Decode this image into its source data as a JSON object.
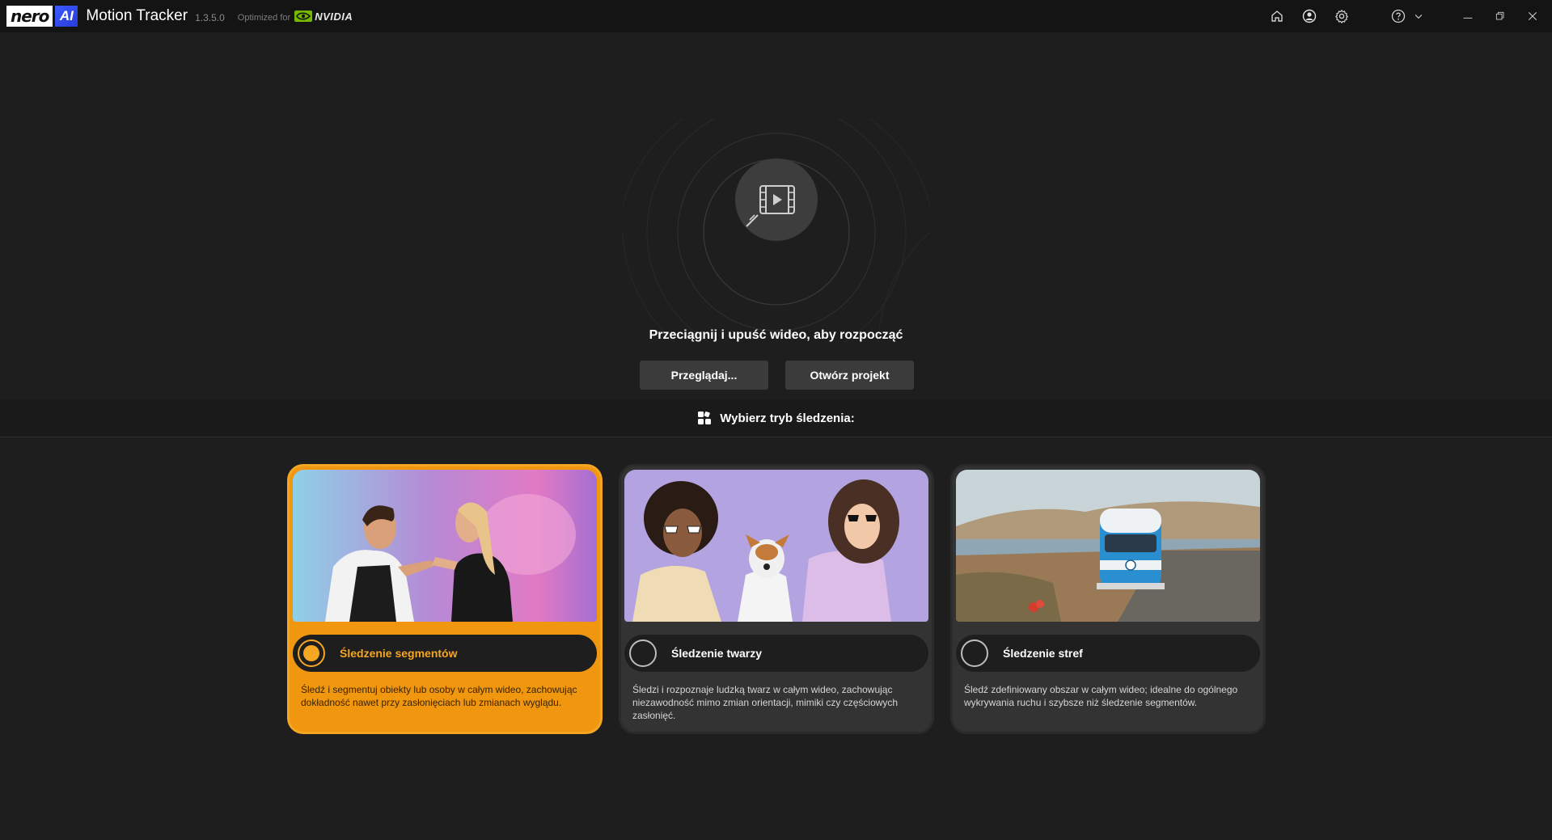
{
  "titlebar": {
    "logo_nero": "nero",
    "logo_ai": "AI",
    "app_name": "Motion Tracker",
    "version": "1.3.5.0",
    "optimized_for": "Optimized for",
    "nvidia": "NVIDIA",
    "icons": [
      "home-icon",
      "account-icon",
      "settings-icon",
      "help-icon",
      "chevron-down-icon",
      "minimize-icon",
      "restore-icon",
      "close-icon"
    ]
  },
  "drop": {
    "title": "Przeciągnij i upuść wideo, aby rozpocząć",
    "browse_label": "Przeglądaj...",
    "open_project_label": "Otwórz projekt"
  },
  "modes": {
    "header": "Wybierz tryb śledzenia:",
    "selected": "segments",
    "cards": [
      {
        "id": "segments",
        "label": "Śledzenie segmentów",
        "description": "Śledź i segmentuj obiekty lub osoby w całym wideo, zachowując dokładność nawet przy zasłonięciach lub zmianach wyglądu."
      },
      {
        "id": "faces",
        "label": "Śledzenie twarzy",
        "description": "Śledzi i rozpoznaje ludzką twarz w całym wideo, zachowując niezawodność mimo zmian orientacji, mimiki czy częściowych zasłonięć."
      },
      {
        "id": "zones",
        "label": "Śledzenie stref",
        "description": "Śledź zdefiniowany obszar w całym wideo; idealne do ogólnego wykrywania ruchu i szybsze niż śledzenie segmentów."
      }
    ]
  },
  "colors": {
    "accent": "#f5a623",
    "background": "#1e1e1e",
    "titlebar": "#141414",
    "card": "#333333",
    "button": "#3b3b3b",
    "nvidia_green": "#76b900"
  }
}
